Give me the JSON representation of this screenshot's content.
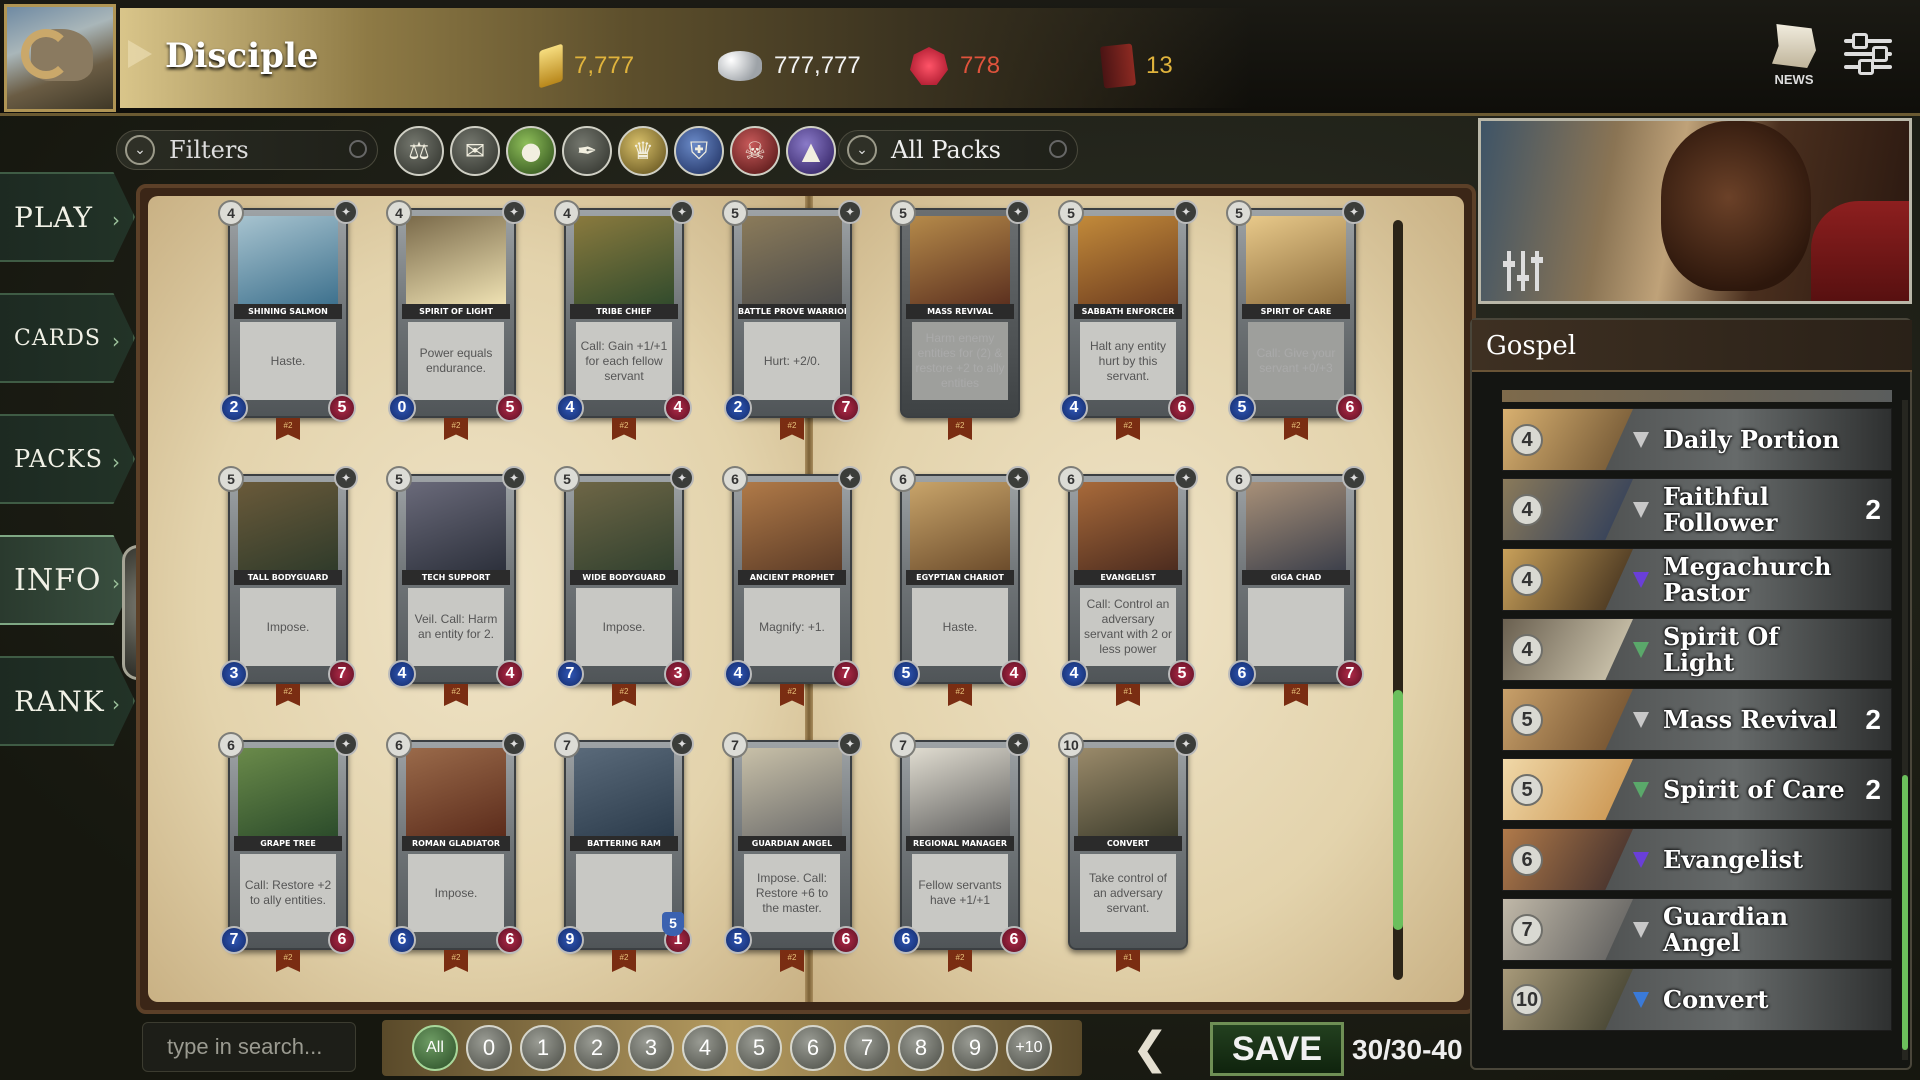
{
  "header": {
    "title": "Disciple",
    "gold": "7,777",
    "silver": "777,777",
    "gems": "778",
    "tomes": "13",
    "news_label": "NEWS"
  },
  "nav": {
    "items": [
      {
        "label": "PLAY"
      },
      {
        "label": "CARDS"
      },
      {
        "label": "PACKS"
      },
      {
        "label": "INFO"
      },
      {
        "label": "RANK"
      }
    ]
  },
  "filters": {
    "label": "Filters",
    "packs_label": "All Packs",
    "factions": [
      "scales-icon",
      "scroll-icon",
      "apple-icon",
      "feather-icon",
      "crown-icon",
      "shield-icon",
      "skull-icon",
      "eye-triangle-icon"
    ]
  },
  "cards": [
    {
      "cost": "4",
      "name": "SHINING SALMON",
      "text": "Haste.",
      "attack": "2",
      "health": "5",
      "pack": "#2",
      "art": [
        "#3b6f8c",
        "#a7c3cf"
      ]
    },
    {
      "cost": "4",
      "name": "SPIRIT OF LIGHT",
      "text": "Power equals endurance.",
      "attack": "0",
      "health": "5",
      "pack": "#2",
      "art": [
        "#f2e5b6",
        "#7a6a4a"
      ]
    },
    {
      "cost": "4",
      "name": "TRIBE CHIEF",
      "text": "Call: Gain +1/+1 for each fellow servant",
      "attack": "4",
      "health": "4",
      "pack": "#2",
      "art": [
        "#2f4a2c",
        "#8a7a3e"
      ]
    },
    {
      "cost": "5",
      "name": "BATTLE PROVE WARRIOR",
      "text": "Hurt: +2/0.",
      "attack": "2",
      "health": "7",
      "pack": "#2",
      "art": [
        "#4a4a4a",
        "#8b7b5a"
      ]
    },
    {
      "cost": "5",
      "name": "MASS REVIVAL",
      "text": "Harm enemy entities for (2) & restore +2 to ally entities",
      "attack": "",
      "health": "",
      "pack": "#2",
      "art": [
        "#5a2e1e",
        "#b58a4a"
      ],
      "dim": true
    },
    {
      "cost": "5",
      "name": "SABBATH ENFORCER",
      "text": "Halt any entity hurt by this servant.",
      "attack": "4",
      "health": "6",
      "pack": "#2",
      "art": [
        "#6b3a1e",
        "#c28a3a"
      ]
    },
    {
      "cost": "5",
      "name": "SPIRIT OF CARE",
      "text": "Call: Give your servant +0/+3",
      "attack": "5",
      "health": "6",
      "pack": "#2",
      "art": [
        "#8a6a3a",
        "#e8c98a"
      ],
      "dim": true
    },
    {
      "cost": "5",
      "name": "TALL BODYGUARD",
      "text": "Impose.",
      "attack": "3",
      "health": "7",
      "pack": "#2",
      "art": [
        "#2e3a2a",
        "#6a5a3a"
      ]
    },
    {
      "cost": "5",
      "name": "TECH SUPPORT",
      "text": "Veil. Call: Harm an entity for 2.",
      "attack": "4",
      "health": "4",
      "pack": "#2",
      "art": [
        "#2b2f3a",
        "#6a6a7a"
      ]
    },
    {
      "cost": "5",
      "name": "WIDE BODYGUARD",
      "text": "Impose.",
      "attack": "7",
      "health": "3",
      "pack": "#2",
      "art": [
        "#30402e",
        "#6e6646"
      ]
    },
    {
      "cost": "6",
      "name": "ANCIENT PROPHET",
      "text": "Magnify: +1.",
      "attack": "4",
      "health": "7",
      "pack": "#2",
      "art": [
        "#5a3a26",
        "#b07a48"
      ]
    },
    {
      "cost": "6",
      "name": "EGYPTIAN CHARIOT",
      "text": "Haste.",
      "attack": "5",
      "health": "4",
      "pack": "#2",
      "art": [
        "#6a4a2a",
        "#c8a46a"
      ]
    },
    {
      "cost": "6",
      "name": "EVANGELIST",
      "text": "Call: Control an adversary servant with 2 or less power",
      "attack": "4",
      "health": "5",
      "pack": "#1",
      "art": [
        "#4a2a1e",
        "#a86a3a"
      ]
    },
    {
      "cost": "6",
      "name": "GIGA CHAD",
      "text": "",
      "attack": "6",
      "health": "7",
      "pack": "#2",
      "art": [
        "#3a3e4a",
        "#a89078"
      ]
    },
    {
      "cost": "6",
      "name": "GRAPE TREE",
      "text": "Call: Restore +2 to ally entities.",
      "attack": "7",
      "health": "6",
      "pack": "#2",
      "art": [
        "#2a4a2a",
        "#6a8a4a"
      ]
    },
    {
      "cost": "6",
      "name": "ROMAN GLADIATOR",
      "text": "Impose.",
      "attack": "6",
      "health": "6",
      "pack": "#2",
      "art": [
        "#5a2a1a",
        "#9a6a4a"
      ]
    },
    {
      "cost": "7",
      "name": "BATTERING RAM",
      "text": "",
      "attack": "9",
      "health": "1",
      "pack": "#2",
      "art": [
        "#2a3a4a",
        "#5a6a7a"
      ],
      "badge": "5"
    },
    {
      "cost": "7",
      "name": "GUARDIAN ANGEL",
      "text": "Impose. Call: Restore +6 to the master.",
      "attack": "5",
      "health": "6",
      "pack": "#2",
      "art": [
        "#6a6a6a",
        "#c8c0a8"
      ]
    },
    {
      "cost": "7",
      "name": "REGIONAL MANAGER",
      "text": "Fellow servants have +1/+1",
      "attack": "6",
      "health": "6",
      "pack": "#2",
      "art": [
        "#5a5a5a",
        "#e0dcd0"
      ]
    },
    {
      "cost": "10",
      "name": "CONVERT",
      "text": "Take control of an adversary servant.",
      "attack": "",
      "health": "",
      "pack": "#1",
      "art": [
        "#3a3a2a",
        "#9a8a6a"
      ]
    }
  ],
  "deck": {
    "title": "Gospel",
    "entries": [
      {
        "cost": "4",
        "name": "Daily Portion",
        "count": "",
        "gem": "#c8c8c8",
        "art": [
          "#6a5030",
          "#d8b070"
        ]
      },
      {
        "cost": "4",
        "name": "Faithful Follower",
        "count": "2",
        "gem": "#c8c8c8",
        "art": [
          "#2a3a5a",
          "#8a7a5a"
        ]
      },
      {
        "cost": "4",
        "name": "Megachurch Pastor",
        "count": "",
        "gem": "#6a3fd8",
        "art": [
          "#3a2a1a",
          "#c8a05a"
        ]
      },
      {
        "cost": "4",
        "name": "Spirit Of Light",
        "count": "",
        "gem": "#5aa86a",
        "art": [
          "#d8d0b8",
          "#6a6050"
        ]
      },
      {
        "cost": "5",
        "name": "Mass Revival",
        "count": "2",
        "gem": "#c8c8c8",
        "art": [
          "#6a4a2a",
          "#c8a06a"
        ]
      },
      {
        "cost": "5",
        "name": "Spirit of Care",
        "count": "2",
        "gem": "#5aa86a",
        "art": [
          "#c8904a",
          "#f0d8a8"
        ]
      },
      {
        "cost": "6",
        "name": "Evangelist",
        "count": "",
        "gem": "#6a3fd8",
        "art": [
          "#3a2a2a",
          "#b07a4a"
        ]
      },
      {
        "cost": "7",
        "name": "Guardian Angel",
        "count": "",
        "gem": "#c8c8c8",
        "art": [
          "#5a5a5a",
          "#c0b8a8"
        ]
      },
      {
        "cost": "10",
        "name": "Convert",
        "count": "",
        "gem": "#3a7ad8",
        "art": [
          "#3a3a2a",
          "#a89a7a"
        ]
      }
    ]
  },
  "bottom": {
    "search_placeholder": "type in search...",
    "cost_filters": [
      "All",
      "0",
      "1",
      "2",
      "3",
      "4",
      "5",
      "6",
      "7",
      "8",
      "9",
      "+10"
    ],
    "save_label": "SAVE",
    "deck_count": "30/30-40"
  },
  "colors": {
    "accent_green": "#6bbf5c",
    "gold_text": "#e0b33c",
    "ruby_text": "#e0533c"
  }
}
